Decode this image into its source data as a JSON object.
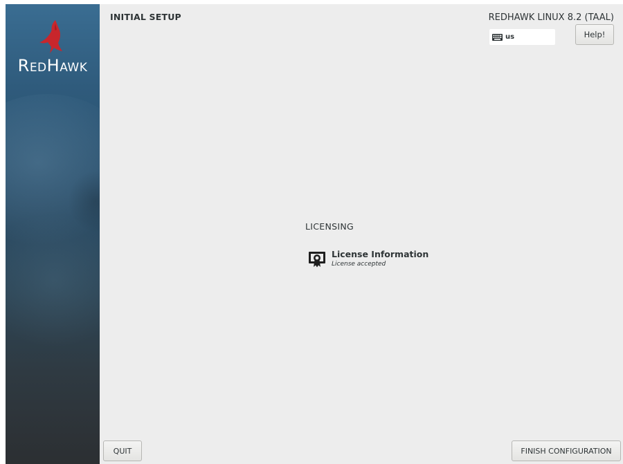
{
  "brand": {
    "logo_text": "RedHawk",
    "bird_color": "#c8262c"
  },
  "header": {
    "title": "INITIAL SETUP",
    "product": "REDHAWK LINUX 8.2 (TAAL)",
    "keyboard_layout": "us",
    "help_label": "Help!"
  },
  "main": {
    "section_title": "LICENSING",
    "spokes": [
      {
        "title": "License Information",
        "status": "License accepted",
        "icon": "license-certificate-icon"
      }
    ]
  },
  "footer": {
    "quit_label": "QUIT",
    "finish_label": "FINISH CONFIGURATION"
  },
  "colors": {
    "main_background": "#ededed",
    "text": "#2e3436"
  }
}
